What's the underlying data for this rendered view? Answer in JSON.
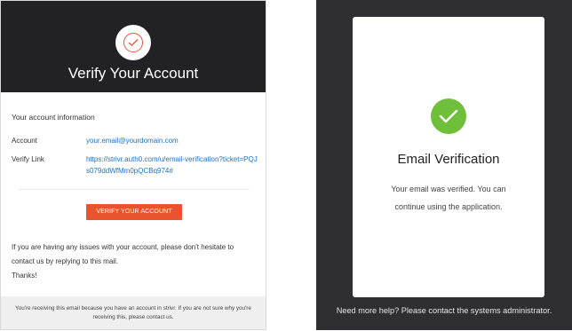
{
  "email": {
    "title": "Verify Your Account",
    "logo_icon": "check-circle-logo-icon",
    "section_heading": "Your account information",
    "account_label": "Account",
    "account_value": "your.email@yourdomain.com",
    "verify_link_label": "Verify Link",
    "verify_link_value": "https://strivr.auth0.com/u/email-verification?ticket=PQJs079ddWfMm0pQCBq974#",
    "button_label": "VERIFY YOUR ACCOUNT",
    "body_line1": "If you are having any issues with your account, please don't hesitate to",
    "body_line2": "contact us by replying to this mail.",
    "body_line3": "Thanks!",
    "footer_line1": "You're receiving this email because you have an account in strivr. If you are not sure why you're",
    "footer_line2": "receiving this, please contact us.",
    "colors": {
      "header_bg": "#222124",
      "button_bg": "#e8542e",
      "link": "#1f72c6"
    }
  },
  "verification": {
    "check_icon": "checkmark-icon",
    "title": "Email Verification",
    "message": "Your email was verified. You can continue using the application.",
    "help_text": "Need more help? Please contact the systems administrator.",
    "colors": {
      "page_bg": "#2f2e31",
      "check_bg": "#6fbf3b"
    }
  }
}
